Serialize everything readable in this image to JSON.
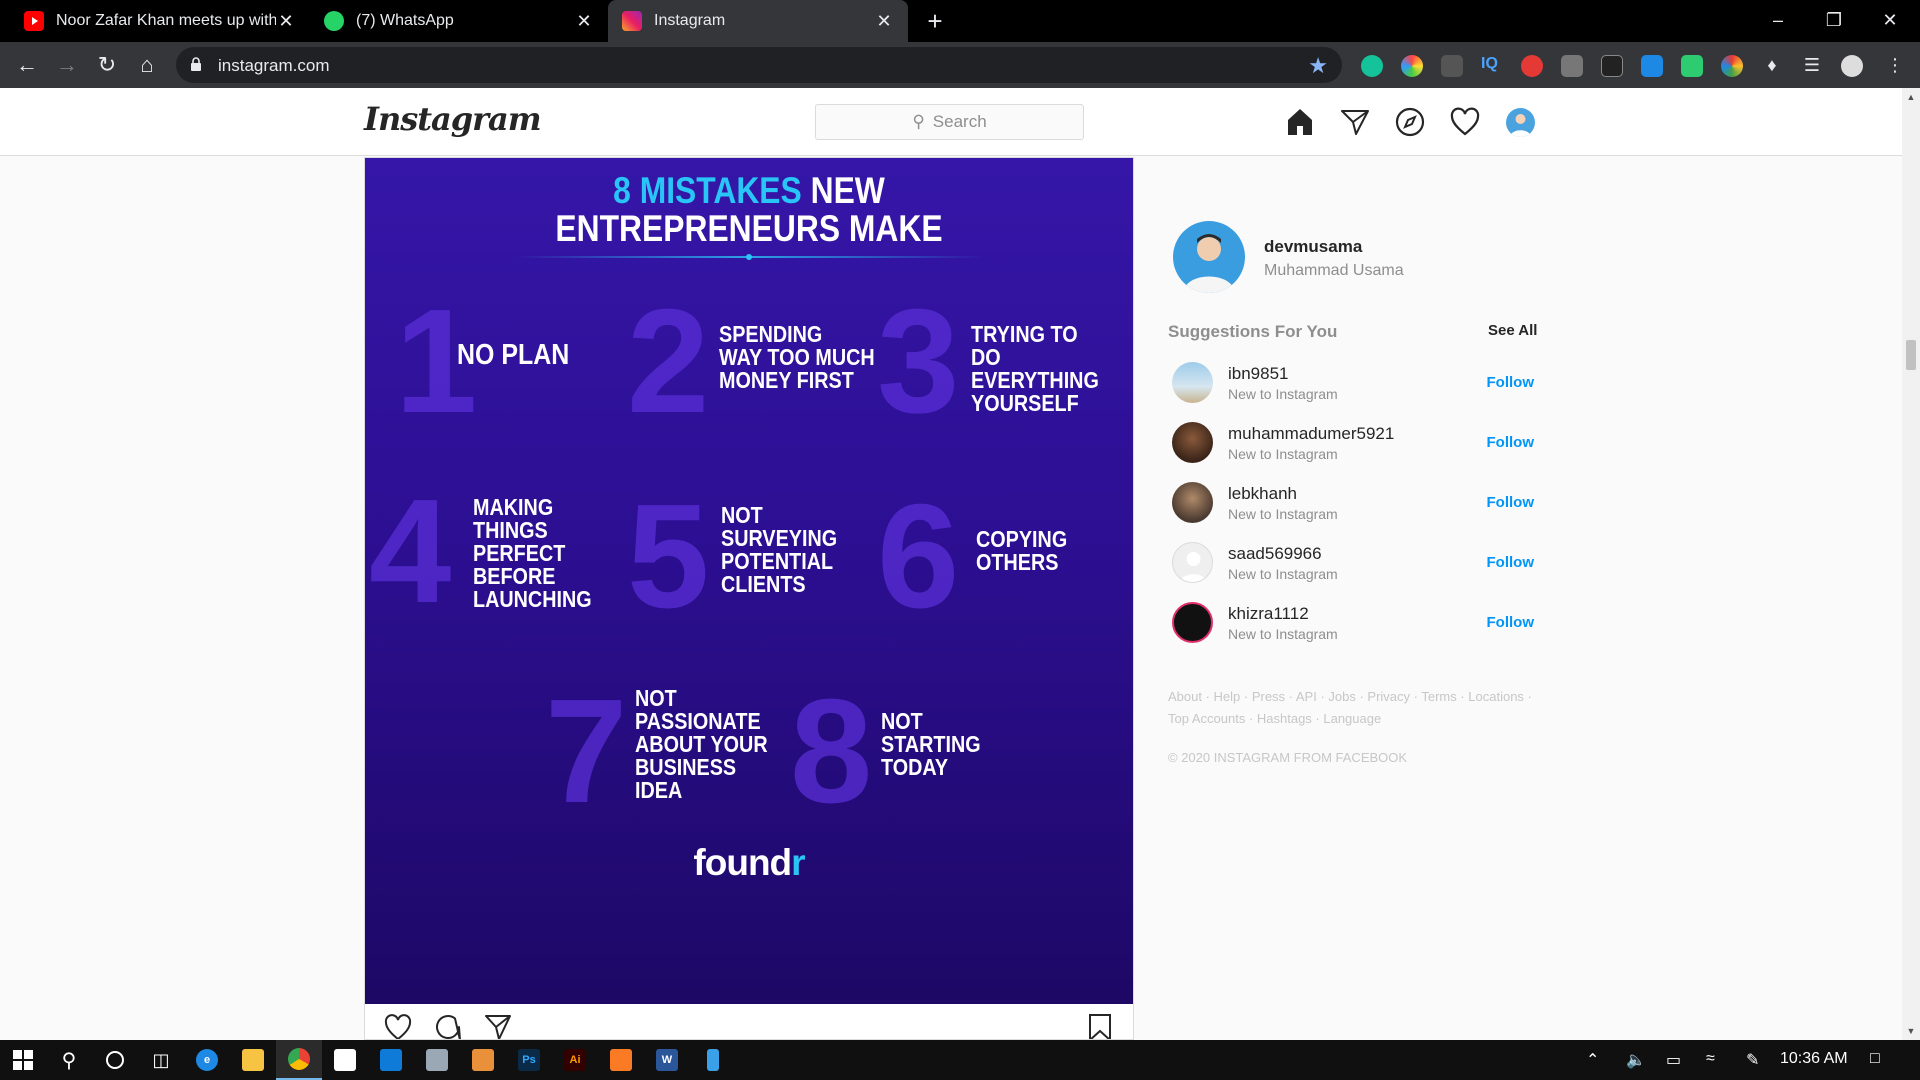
{
  "browser": {
    "tabs": [
      {
        "title": "Noor Zafar Khan meets up with V",
        "icon": "youtube-icon",
        "active": false
      },
      {
        "title": "(7) WhatsApp",
        "icon": "whatsapp-icon",
        "active": false
      },
      {
        "title": "Instagram",
        "icon": "instagram-icon",
        "active": true
      }
    ],
    "tab_close_glyph": "✕",
    "new_tab_glyph": "+",
    "window_controls": {
      "minimize": "–",
      "restore": "❐",
      "close": "✕"
    },
    "url": "instagram.com",
    "bookmark_star": "★"
  },
  "instagram": {
    "logo": "Instagram",
    "search_placeholder": "Search",
    "search_icon_glyph": "⚲"
  },
  "post": {
    "title_highlight": "8 MISTAKES",
    "title_rest": " NEW",
    "title_line2": "ENTREPRENEURS MAKE",
    "mistakes": [
      {
        "num": "1",
        "text": "NO PLAN"
      },
      {
        "num": "2",
        "text": "SPENDING\nWAY TOO MUCH\nMONEY FIRST"
      },
      {
        "num": "3",
        "text": "TRYING TO DO\nEVERYTHING\nYOURSELF"
      },
      {
        "num": "4",
        "text": "MAKING\nTHINGS\nPERFECT\nBEFORE\nLAUNCHING"
      },
      {
        "num": "5",
        "text": "NOT\nSURVEYING\nPOTENTIAL\nCLIENTS"
      },
      {
        "num": "6",
        "text": "COPYING\nOTHERS"
      },
      {
        "num": "7",
        "text": "NOT\nPASSIONATE\nABOUT YOUR\nBUSINESS\nIDEA"
      },
      {
        "num": "8",
        "text": "NOT\nSTARTING\nTODAY"
      }
    ],
    "brand_main": "found",
    "brand_accent": "r"
  },
  "sidebar": {
    "username": "devmusama",
    "full_name": "Muhammad Usama",
    "suggestions_title": "Suggestions For You",
    "see_all": "See All",
    "suggestions": [
      {
        "username": "ibn9851",
        "subtitle": "New to Instagram",
        "action": "Follow"
      },
      {
        "username": "muhammadumer5921",
        "subtitle": "New to Instagram",
        "action": "Follow"
      },
      {
        "username": "lebkhanh",
        "subtitle": "New to Instagram",
        "action": "Follow"
      },
      {
        "username": "saad569966",
        "subtitle": "New to Instagram",
        "action": "Follow"
      },
      {
        "username": "khizra1112",
        "subtitle": "New to Instagram",
        "action": "Follow"
      }
    ],
    "footer_line1": "About · Help · Press · API · Jobs · Privacy · Terms · Locations ·",
    "footer_line2": "Top Accounts · Hashtags · Language",
    "copyright": "© 2020 INSTAGRAM FROM FACEBOOK"
  },
  "taskbar": {
    "time": "10:36 AM",
    "apps": [
      "start",
      "search",
      "cortana",
      "task-view",
      "edge",
      "file-explorer",
      "chrome",
      "store",
      "mail",
      "camera",
      "photos",
      "photoshop",
      "illustrator",
      "xampp",
      "word",
      "notepad"
    ]
  },
  "colors": {
    "ig_blue": "#0095f6",
    "post_bg": "#2c0f92",
    "post_accent": "#29c5f6",
    "chrome_dark": "#35363a"
  }
}
